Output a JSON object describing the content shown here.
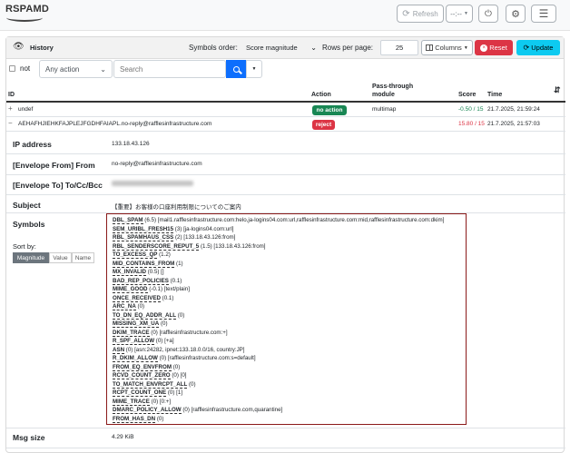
{
  "brand": {
    "name": "RSPAMD"
  },
  "navbar": {
    "refresh_label": "Refresh",
    "interval_value": "--:--"
  },
  "history": {
    "title": "History",
    "symbols_order_label": "Symbols order:",
    "symbols_order_value": "Score magnitude",
    "rows_per_page_label": "Rows per page:",
    "rows_per_page_value": "25",
    "columns_label": "Columns",
    "reset_label": "Reset",
    "update_label": "Update"
  },
  "filter": {
    "not_label": "not",
    "action_value": "Any action",
    "search_placeholder": "Search"
  },
  "table": {
    "headers": {
      "id": "ID",
      "action": "Action",
      "pass_through_1": "Pass-through",
      "pass_through_2": "module",
      "score": "Score",
      "time": "Time"
    },
    "rows": [
      {
        "toggle": "+",
        "id": "undef",
        "action": "no action",
        "pass_through": "multimap",
        "score": "-0.50 / 15",
        "time": "21.7.2025, 21:59:24"
      },
      {
        "toggle": "−",
        "id": "AEHAFHJIEHKFAJPLEJFGDHFAIAPL.no-reply@rafflesinfrastructure.com",
        "action": "reject",
        "pass_through": "",
        "score": "15.80 / 15",
        "time": "21.7.2025, 21:57:03"
      }
    ]
  },
  "detail": {
    "ip_label": "IP address",
    "ip_value": "133.18.43.126",
    "env_from_label": "[Envelope From] From",
    "env_from_value": "no-reply@rafflesinfrastructure.com",
    "env_to_label": "[Envelope To] To/Cc/Bcc",
    "subject_label": "Subject",
    "subject_value": "【重要】お客様の口座利用制限についてのご案内",
    "symbols_label": "Symbols",
    "sort_by_label": "Sort by:",
    "sort_options": [
      "Magnitude",
      "Value",
      "Name"
    ],
    "msg_size_label": "Msg size",
    "msg_size_value": "4.29 KiB"
  },
  "symbols": [
    {
      "name": "DBL_SPAM",
      "rest": " (6.5) [mail1.rafflesinfrastructure.com:helo,ja-logins04.com:url,rafflesinfrastructure.com:mid,rafflesinfrastructure.com:dkim]"
    },
    {
      "name": "SEM_URIBL_FRESH15",
      "rest": " (3) [ja-logins04.com:url]"
    },
    {
      "name": "RBL_SPAMHAUS_CSS",
      "rest": " (2) [133.18.43.126:from]"
    },
    {
      "name": "RBL_SENDERSCORE_REPUT_5",
      "rest": " (1.5) [133.18.43.126:from]"
    },
    {
      "name": "TO_EXCESS_QP",
      "rest": " (1.2)"
    },
    {
      "name": "MID_CONTAINS_FROM",
      "rest": " (1)"
    },
    {
      "name": "MX_INVALID",
      "rest": " (0.5) []"
    },
    {
      "name": "BAD_REP_POLICIES",
      "rest": " (0.1)"
    },
    {
      "name": "MIME_GOOD",
      "rest": " (-0.1) [text/plain]"
    },
    {
      "name": "ONCE_RECEIVED",
      "rest": " (0.1)"
    },
    {
      "name": "ARC_NA",
      "rest": " (0)"
    },
    {
      "name": "TO_DN_EQ_ADDR_ALL",
      "rest": " (0)"
    },
    {
      "name": "MISSING_XM_UA",
      "rest": " (0)"
    },
    {
      "name": "DKIM_TRACE",
      "rest": " (0) [rafflesinfrastructure.com:+]"
    },
    {
      "name": "R_SPF_ALLOW",
      "rest": " (0) [+a]"
    },
    {
      "name": "ASN",
      "rest": " (0) [asn:24282, ipnet:133.18.0.0/16, country:JP]"
    },
    {
      "name": "R_DKIM_ALLOW",
      "rest": " (0) [rafflesinfrastructure.com:s=default]"
    },
    {
      "name": "FROM_EQ_ENVFROM",
      "rest": " (0)"
    },
    {
      "name": "RCVD_COUNT_ZERO",
      "rest": " (0) [0]"
    },
    {
      "name": "TO_MATCH_ENVRCPT_ALL",
      "rest": " (0)"
    },
    {
      "name": "RCPT_COUNT_ONE",
      "rest": " (0) [1]"
    },
    {
      "name": "MIME_TRACE",
      "rest": " (0) [0:+]"
    },
    {
      "name": "DMARC_POLICY_ALLOW",
      "rest": " (0) [rafflesinfrastructure.com,quarantine]"
    },
    {
      "name": "FROM_HAS_DN",
      "rest": " (0)"
    }
  ],
  "colors": {
    "accent": "#0d6efd",
    "reject": "#dc3545",
    "no_action": "#198754",
    "update": "#0dcaf0",
    "symbol_border": "#8b1a1a"
  }
}
